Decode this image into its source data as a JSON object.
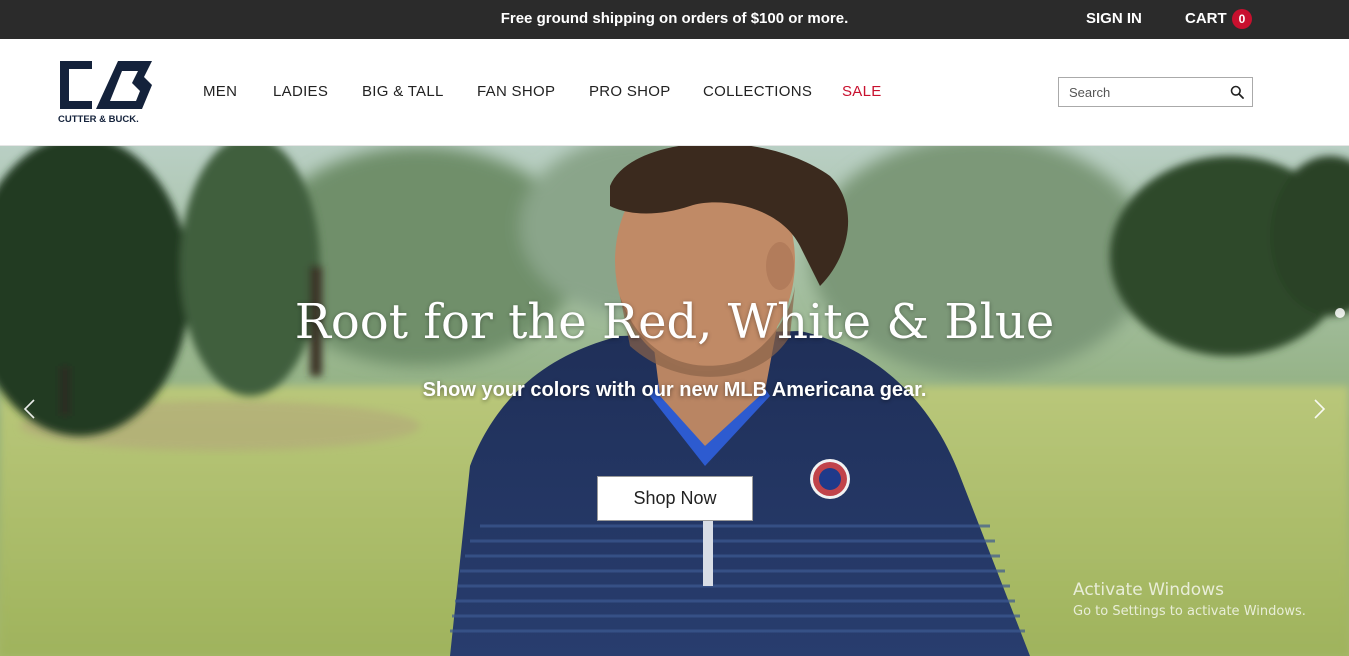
{
  "topbar": {
    "promo_text": "Free ground shipping on orders of $100 or more.",
    "sign_in_label": "SIGN IN",
    "cart_label": "CART",
    "cart_count": "0"
  },
  "header": {
    "logo_text": "CUTTER & BUCK.",
    "nav": [
      {
        "label": "MEN"
      },
      {
        "label": "LADIES"
      },
      {
        "label": "BIG & TALL"
      },
      {
        "label": "FAN SHOP"
      },
      {
        "label": "PRO SHOP"
      },
      {
        "label": "COLLECTIONS"
      },
      {
        "label": "SALE"
      }
    ],
    "search": {
      "placeholder": "Search"
    }
  },
  "hero": {
    "title": "Root for the Red, White & Blue",
    "subtitle": "Show your colors with our new MLB Americana gear.",
    "cta_label": "Shop Now"
  },
  "watermark": {
    "line1": "Activate Windows",
    "line2": "Go to Settings to activate Windows."
  },
  "colors": {
    "topbar_bg": "#2b2b2b",
    "brand_navy": "#14223b",
    "sale_red": "#c8102e",
    "cart_badge": "#c8102e"
  },
  "icons": [
    "search-icon",
    "chevron-left-icon",
    "chevron-right-icon",
    "cutter-buck-logo"
  ]
}
